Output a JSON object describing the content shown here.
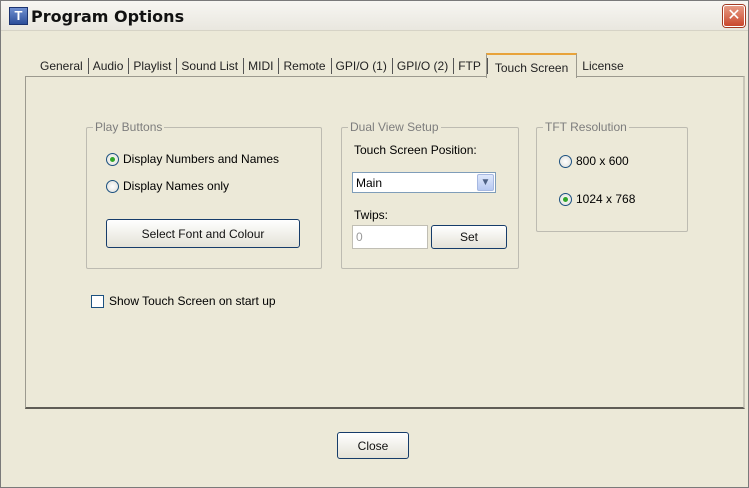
{
  "window": {
    "title": "Program Options",
    "icon_letter": "T",
    "close_glyph": "✕"
  },
  "tabs": [
    {
      "label": "General"
    },
    {
      "label": "Audio"
    },
    {
      "label": "Playlist"
    },
    {
      "label": "Sound List"
    },
    {
      "label": "MIDI"
    },
    {
      "label": "Remote"
    },
    {
      "label": "GPI/O (1)"
    },
    {
      "label": "GPI/O (2)"
    },
    {
      "label": "FTP"
    },
    {
      "label": "Touch Screen",
      "active": true
    },
    {
      "label": "License"
    }
  ],
  "play_buttons": {
    "label": "Play Buttons",
    "option_numbers_names": "Display Numbers and Names",
    "option_names_only": "Display Names only",
    "selected": "option_numbers_names",
    "font_button": "Select Font and Colour"
  },
  "show_on_startup": {
    "label": "Show Touch Screen on start up",
    "checked": false
  },
  "dual_view": {
    "label": "Dual View Setup",
    "position_label": "Touch Screen Position:",
    "position_value": "Main",
    "twips_label": "Twips:",
    "twips_value": "0",
    "set_button": "Set"
  },
  "tft": {
    "label": "TFT Resolution",
    "option_800": "800 x 600",
    "option_1024": "1024 x 768",
    "selected": "option_1024"
  },
  "footer": {
    "close_button": "Close"
  },
  "colors": {
    "dialog_bg": "#ece9d8",
    "active_tab_accent": "#e8a33a",
    "radio_check": "#31a62a",
    "close_red": "#c9482e"
  }
}
